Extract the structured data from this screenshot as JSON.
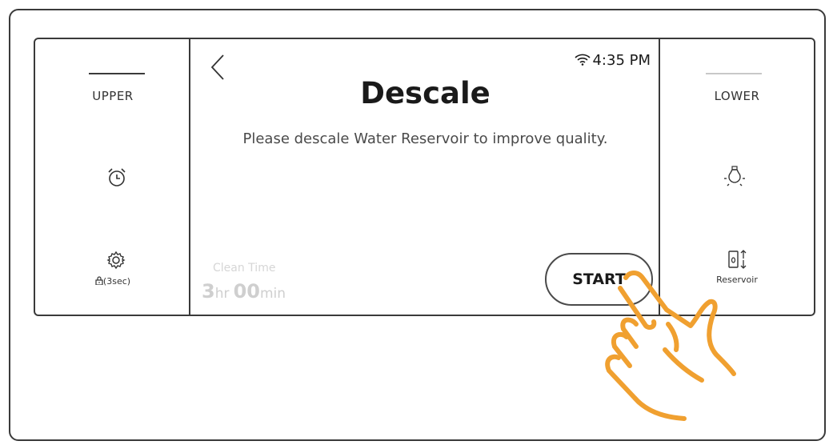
{
  "left_panel": {
    "label": "UPPER",
    "timer_icon": "alarm-clock-icon",
    "settings_icon": "gear-icon",
    "lock_label": "(3sec)",
    "lock_icon": "lock-icon"
  },
  "right_panel": {
    "label": "LOWER",
    "light_icon": "light-bulb-icon",
    "reservoir_label": "Reservoir",
    "reservoir_icon": "reservoir-icon"
  },
  "screen": {
    "time": "4:35 PM",
    "wifi_icon": "wifi-icon",
    "back_icon": "chevron-left-icon",
    "title": "Descale",
    "message": "Please descale Water Reservoir to improve quality.",
    "clean_time_label": "Clean Time",
    "clean_time_hours": "3",
    "clean_time_hours_unit": "hr",
    "clean_time_minutes": "00",
    "clean_time_minutes_unit": "min",
    "start_label": "START"
  },
  "colors": {
    "outline": "#3a3a3a",
    "hand": "#f0a030",
    "faded_text": "#cfcfcf"
  }
}
